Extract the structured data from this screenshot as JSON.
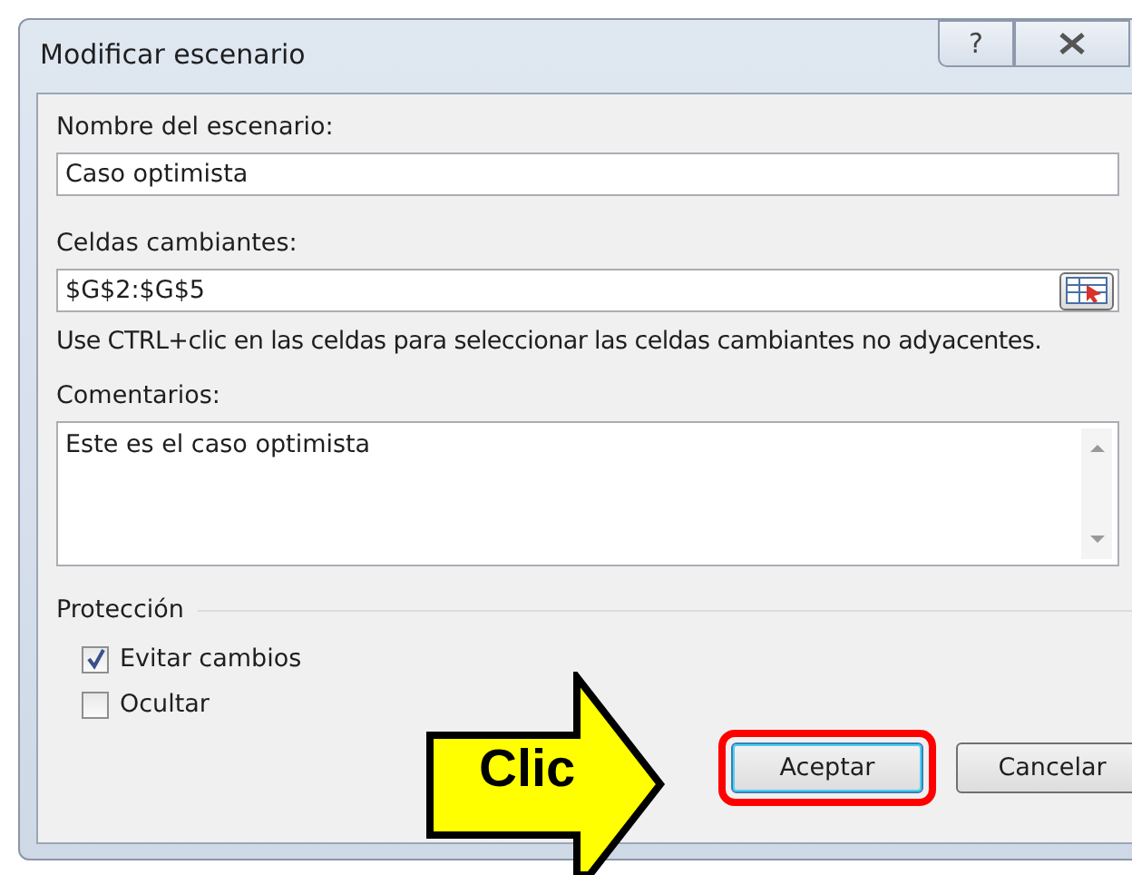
{
  "window": {
    "title": "Modificar escenario",
    "help_button": "?"
  },
  "name_field": {
    "label": "Nombre del escenario:",
    "value": "Caso optimista"
  },
  "cells_field": {
    "label": "Celdas cambiantes:",
    "value": "$G$2:$G$5"
  },
  "hint": "Use CTRL+clic en las celdas para seleccionar las celdas cambiantes no adyacentes.",
  "comments": {
    "label": "Comentarios:",
    "value": "Este es el caso optimista"
  },
  "protection": {
    "title": "Protección",
    "options": [
      {
        "label": "Evitar cambios",
        "checked": true
      },
      {
        "label": "Ocultar",
        "checked": false
      }
    ]
  },
  "buttons": [
    {
      "label": "Aceptar",
      "highlighted": true
    },
    {
      "label": "Cancelar",
      "highlighted": false
    }
  ],
  "callout": {
    "label": "Clic"
  }
}
